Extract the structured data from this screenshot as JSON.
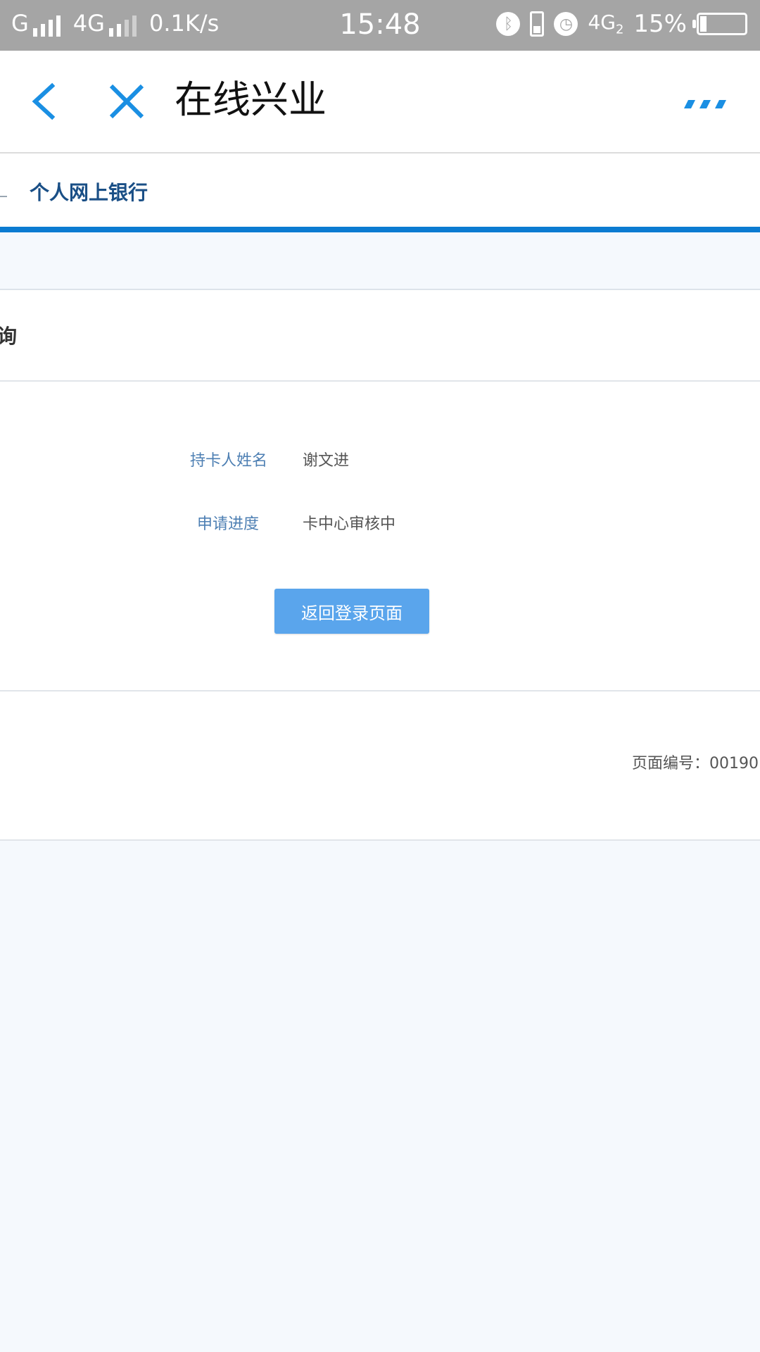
{
  "status_bar": {
    "carrier": "G",
    "network": "4G",
    "speed": "0.1K/s",
    "time": "15:48",
    "network2": "4G",
    "sim_index": "2",
    "battery_text": "15%",
    "battery_level_percent": 15
  },
  "nav": {
    "title": "在线兴业"
  },
  "tabs": {
    "active_label": "个人网上银行"
  },
  "section": {
    "title_fragment": "询"
  },
  "details": {
    "name_label": "持卡人姓名",
    "name_value": "谢文进",
    "progress_label": "申请进度",
    "progress_value": "卡中心审核中"
  },
  "actions": {
    "return_button": "返回登录页面"
  },
  "footer": {
    "page_number_label": "页面编号：",
    "page_number_value": "00190"
  },
  "colors": {
    "accent": "#0b7bd1",
    "button": "#5aa5ec",
    "label_blue": "#4d7fb3",
    "status_bar": "#a5a5a5"
  }
}
